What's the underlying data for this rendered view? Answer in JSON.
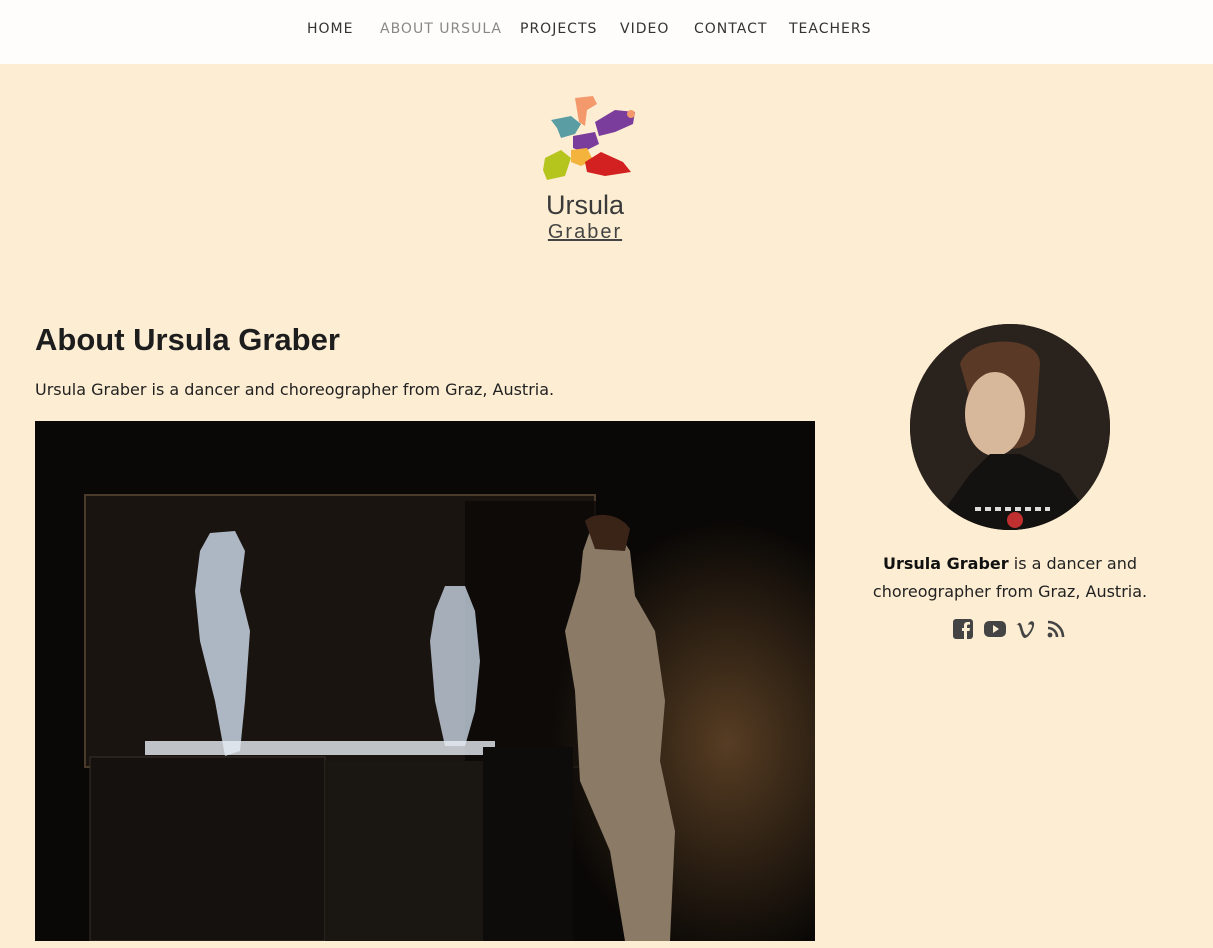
{
  "nav": {
    "items": [
      {
        "label": "HOME"
      },
      {
        "label": "ABOUT URSULA",
        "active": true
      },
      {
        "label": "PROJECTS"
      },
      {
        "label": "VIDEO"
      },
      {
        "label": "CONTACT"
      },
      {
        "label": "TEACHERS"
      }
    ]
  },
  "logo": {
    "name": "Ursula",
    "sub": "Graber"
  },
  "main": {
    "title": "About Ursula Graber",
    "intro": "Ursula Graber is a dancer and choreographer from Graz, Austria."
  },
  "sidebar": {
    "bio_name": "Ursula Graber",
    "bio_rest": " is a dancer and choreographer from Graz, Austria.",
    "social": [
      "facebook-icon",
      "youtube-icon",
      "vimeo-icon",
      "rss-icon"
    ]
  },
  "colors": {
    "background": "#fdeed3",
    "nav_bg": "#fffdfb",
    "text": "#222222",
    "active_nav": "#888888"
  }
}
